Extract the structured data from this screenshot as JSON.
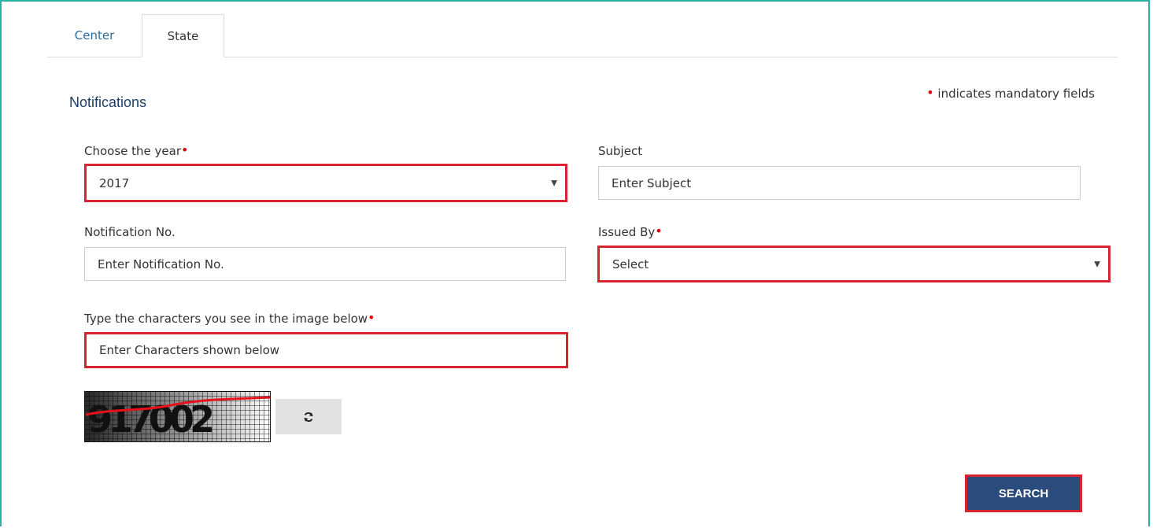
{
  "tabs": [
    {
      "label": "Center"
    },
    {
      "label": "State"
    }
  ],
  "page_title": "Notifications",
  "mandatory_note": "indicates mandatory fields",
  "mandatory_marker": "•",
  "fields": {
    "year": {
      "label": "Choose the year",
      "value": "2017"
    },
    "subject": {
      "label": "Subject",
      "placeholder": "Enter Subject"
    },
    "notification_no": {
      "label": "Notification No.",
      "placeholder": "Enter Notification No."
    },
    "issued_by": {
      "label": "Issued By",
      "value": "Select"
    },
    "captcha_input": {
      "label": "Type the characters you see in the image below",
      "placeholder": "Enter Characters shown below"
    }
  },
  "captcha": {
    "text": "917002"
  },
  "buttons": {
    "search": "SEARCH"
  },
  "colors": {
    "accent": "#26b3a5",
    "primary": "#2a4b7c",
    "required": "#e0000f",
    "highlight": "#d9232e"
  }
}
